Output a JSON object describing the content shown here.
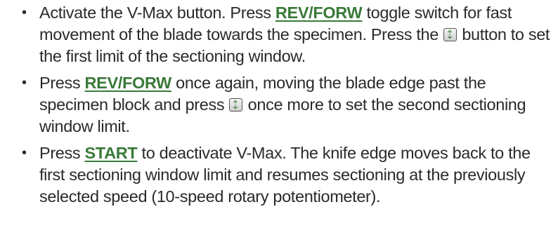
{
  "steps": [
    {
      "segments": [
        {
          "type": "text",
          "value": "Activate the V-Max button. Press "
        },
        {
          "type": "key",
          "value": "REV/FORW"
        },
        {
          "type": "text",
          "value": " toggle switch for fast movement of the blade towards the specimen. Press the "
        },
        {
          "type": "icon",
          "icon": "window-limit-icon"
        },
        {
          "type": "text",
          "value": " button to set the first limit of the sectioning window."
        }
      ]
    },
    {
      "segments": [
        {
          "type": "text",
          "value": "Press "
        },
        {
          "type": "key",
          "value": "REV/FORW"
        },
        {
          "type": "text",
          "value": " once again, moving the blade edge past the specimen block and press "
        },
        {
          "type": "icon",
          "icon": "window-limit-icon"
        },
        {
          "type": "text",
          "value": " once more to set the second sectioning window limit."
        }
      ]
    },
    {
      "segments": [
        {
          "type": "text",
          "value": "Press "
        },
        {
          "type": "key",
          "value": "START"
        },
        {
          "type": "text",
          "value": " to deactivate V-Max. The knife edge moves back to the first sectioning window limit and resumes sectioning at the previously selected speed (10-speed rotary potentiometer)."
        }
      ]
    }
  ],
  "colors": {
    "key_text": "#3a7a3a",
    "body_text": "#2a2a2a"
  }
}
